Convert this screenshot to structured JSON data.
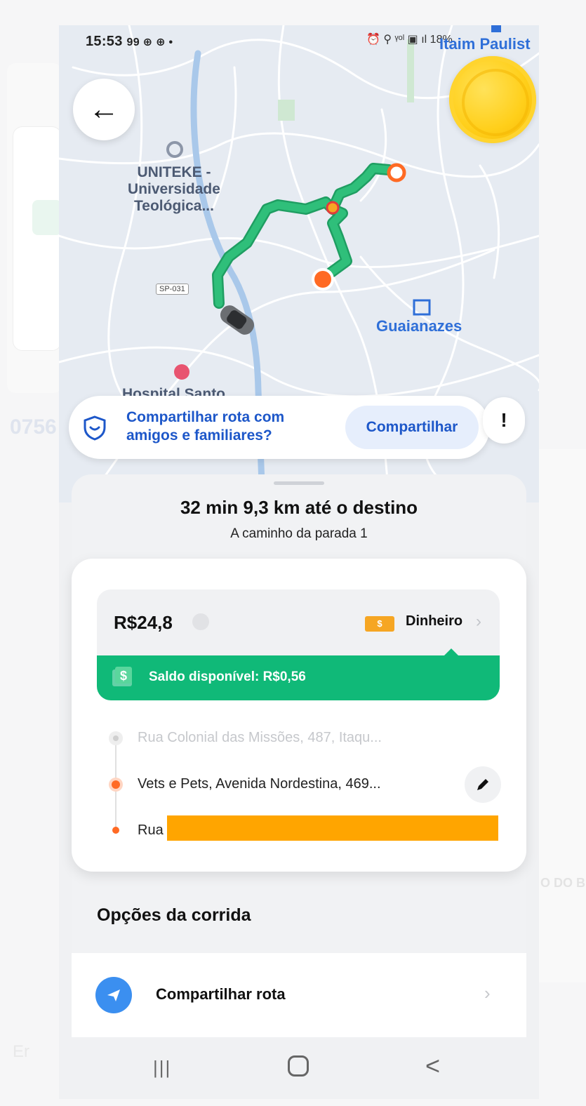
{
  "background": {
    "left_text": "0756",
    "right_text": "O DO B",
    "bottom_left_text": "Er"
  },
  "status_bar": {
    "time": "15:53",
    "left_icons": "99 ⊕ ⊕ •",
    "right_icons": "⏰ ⚲ ᵞᵒˡ ▣ ıl 18%"
  },
  "map": {
    "labels": {
      "itaim": "Itaim Paulist",
      "uniteke": "UNITEKE - Universidade Teológica...",
      "guaianazes": "Guaianazes",
      "hospital": "Hospital Santo",
      "road": "SP-031"
    },
    "colors": {
      "route": "#22b573",
      "pin": "#ff6a24"
    }
  },
  "share_banner": {
    "text": "Compartilhar rota com amigos e familiares?",
    "button": "Compartilhar"
  },
  "report_button": "!",
  "trip": {
    "eta": "32 min  9,3 km até o destino",
    "subtitle": "A caminho da parada 1"
  },
  "payment": {
    "price": "R$24,8",
    "method_icon_label": "$",
    "method": "Dinheiro",
    "balance": "Saldo disponível: R$0,56"
  },
  "route": {
    "origin": "Rua Colonial das Missões, 487, Itaqu...",
    "stop": "Vets e Pets, Avenida Nordestina, 469...",
    "destination": "Rua"
  },
  "options": {
    "title": "Opções da corrida",
    "items": [
      {
        "label": "Compartilhar rota"
      }
    ]
  },
  "nav": {
    "recent": "|||",
    "back": "<"
  }
}
